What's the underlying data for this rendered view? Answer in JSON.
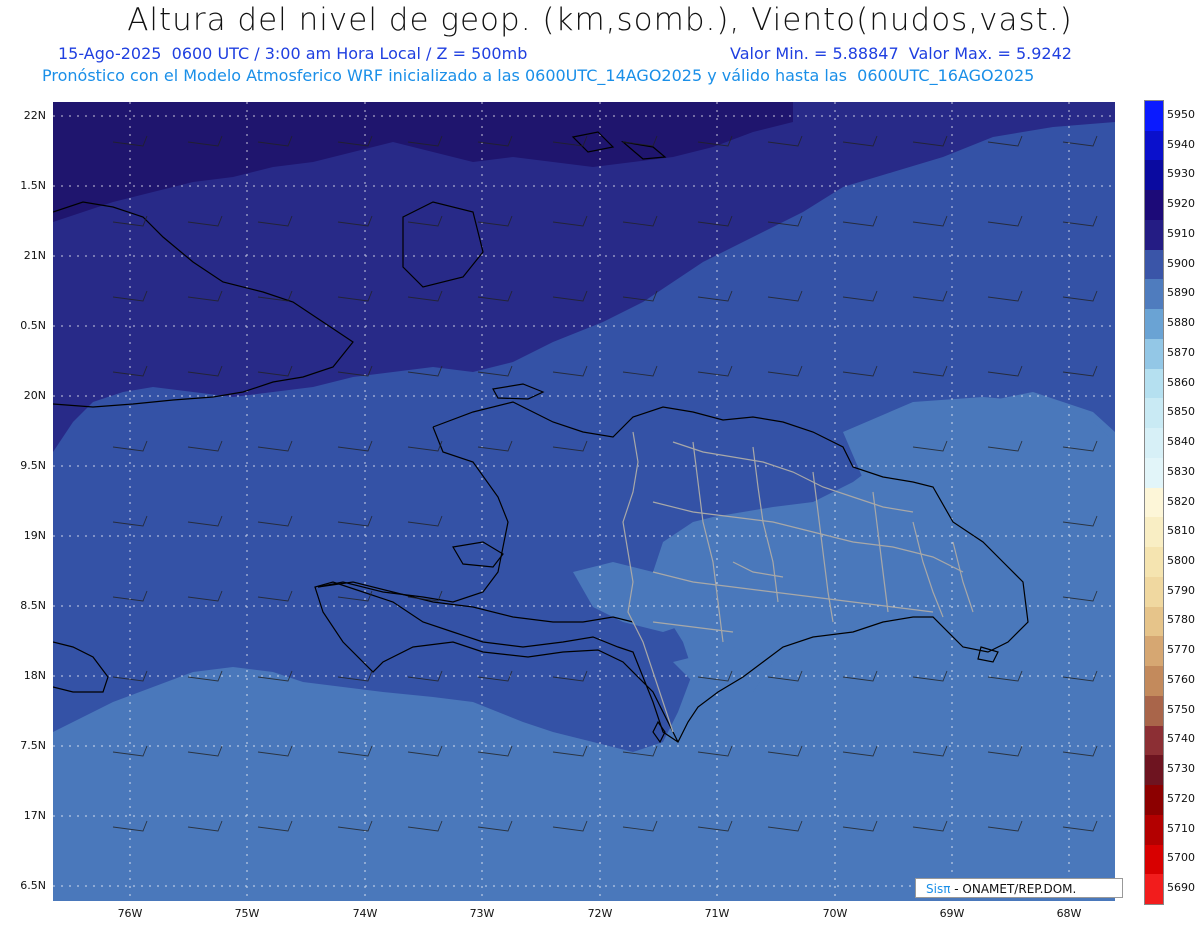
{
  "header": {
    "title": "Altura del nivel de geop. (km,somb.), Viento(nudos,vast.)",
    "line1": "15-Ago-2025  0600 UTC / 3:00 am Hora Local / Z = 500mb",
    "line1_minmax": "Valor Min. = 5.88847  Valor Max. = 5.9242",
    "line2": "Pronóstico con el Modelo Atmosferico WRF inicializado a las 0600UTC_14AGO2025 y válido hasta las  0600UTC_16AGO2025"
  },
  "axes": {
    "y_labels": [
      "22N",
      "1.5N",
      "21N",
      "0.5N",
      "20N",
      "9.5N",
      "19N",
      "8.5N",
      "18N",
      "7.5N",
      "17N",
      "6.5N"
    ],
    "x_labels": [
      "76W",
      "75W",
      "74W",
      "73W",
      "72W",
      "71W",
      "70W",
      "69W",
      "68W"
    ]
  },
  "colorbar": {
    "labels": [
      "5950",
      "5940",
      "5930",
      "5920",
      "5910",
      "5900",
      "5890",
      "5880",
      "5870",
      "5860",
      "5850",
      "5840",
      "5830",
      "5820",
      "5810",
      "5800",
      "5790",
      "5780",
      "5770",
      "5760",
      "5750",
      "5740",
      "5730",
      "5720",
      "5710",
      "5700",
      "5690"
    ],
    "colors": [
      "#0a1aff",
      "#0a10cc",
      "#0a0aa0",
      "#1c0a78",
      "#241c84",
      "#3a55a8",
      "#4f7cbe",
      "#6aa3d4",
      "#93c7e6",
      "#b5e0f0",
      "#c9eaf4",
      "#d7f0f7",
      "#e2f5f9",
      "#fdf6d8",
      "#f9eec4",
      "#f5e4b0",
      "#f0d8a0",
      "#e6c48a",
      "#d6a772",
      "#c38a5c",
      "#a9654a",
      "#8c2f34",
      "#6e1420",
      "#8c0000",
      "#b30000",
      "#d80000",
      "#f21c1c"
    ]
  },
  "fields": {
    "colors": {
      "c5920": "#1f156e",
      "c5910": "#282a88",
      "c5900": "#3452a6",
      "c5890": "#4a78bb",
      "coast": "#000000",
      "border": "#a8a8a8",
      "grid": "#ffffff",
      "barb": "#222222"
    }
  },
  "credit": {
    "sis": "Sisπ",
    "rest": "- ONAMET/REP.DOM."
  }
}
